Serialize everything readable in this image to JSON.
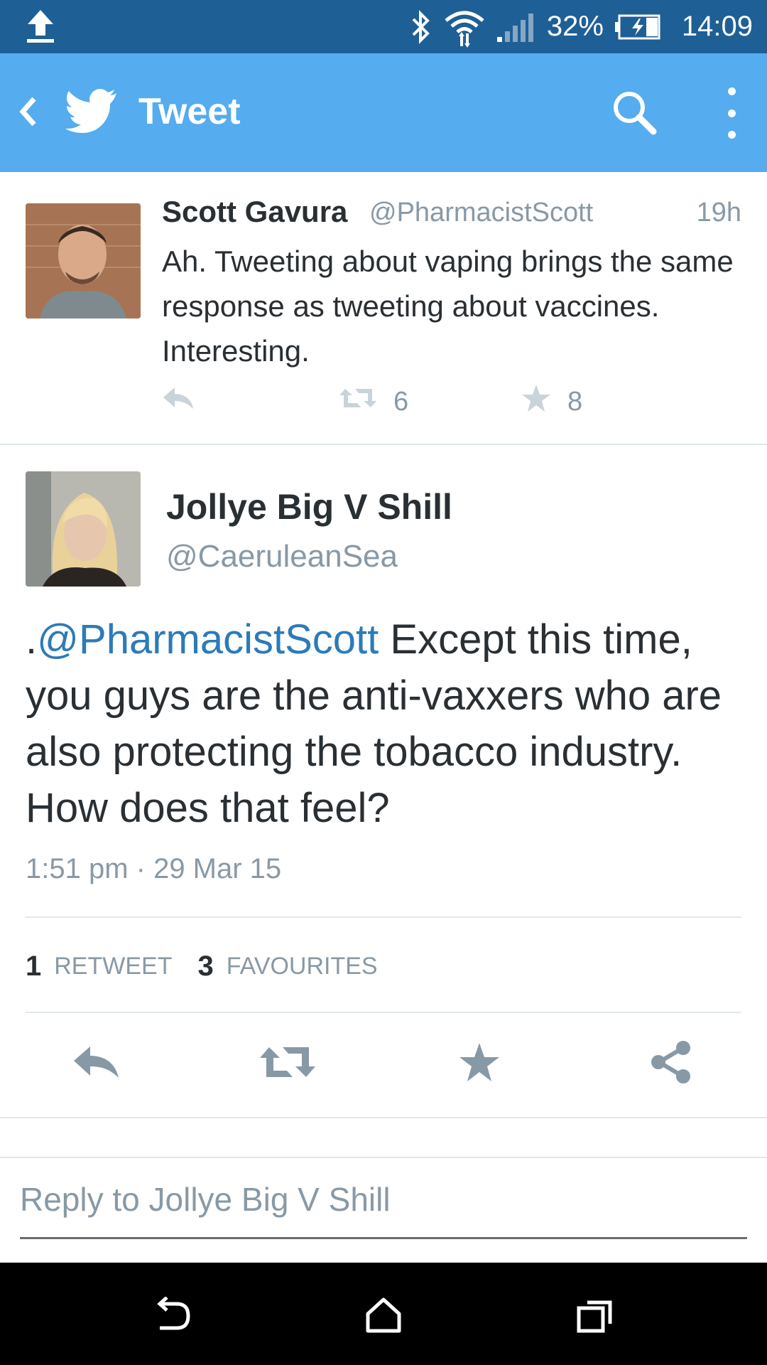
{
  "status_bar": {
    "battery": "32%",
    "time": "14:09"
  },
  "app_bar": {
    "title": "Tweet"
  },
  "parent_tweet": {
    "name": "Scott Gavura",
    "handle": "@PharmacistScott",
    "time": "19h",
    "text": "Ah. Tweeting about vaping brings the same response as tweeting about vaccines.  Interesting.",
    "retweets": "6",
    "favourites": "8"
  },
  "main_tweet": {
    "name": "Jollye Big V Shill",
    "handle": "@CaeruleanSea",
    "prefix": ".",
    "mention": "@PharmacistScott",
    "text": " Except this time, you guys are the anti-vaxxers who are also protecting the tobacco industry. How does that feel?",
    "date": "1:51 pm · 29 Mar 15",
    "retweet_count": "1",
    "retweet_label": "RETWEET",
    "favourite_count": "3",
    "favourite_label": "FAVOURITES"
  },
  "reply_box": {
    "placeholder": "Reply to Jollye Big V Shill"
  },
  "colors": {
    "status_bar": "#1e5f96",
    "app_bar": "#55acee",
    "mention": "#2b7bb9",
    "muted": "#8899a6",
    "icon": "#8899a6"
  },
  "icons": [
    "upload-icon",
    "bluetooth-icon",
    "wifi-icon",
    "signal-icon",
    "battery-icon",
    "back-icon",
    "twitter-bird-icon",
    "search-icon",
    "more-icon",
    "reply-icon",
    "retweet-icon",
    "favourite-icon",
    "share-icon",
    "nav-back-icon",
    "nav-home-icon",
    "nav-recents-icon"
  ]
}
